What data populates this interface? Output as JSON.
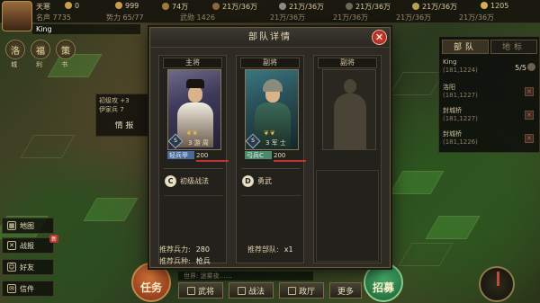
{
  "top_resources": {
    "name_prefix": "天寒",
    "val0": "0",
    "gold": "999",
    "copper": "74万",
    "wood": "21万/36万",
    "iron": "21万/36万",
    "stone": "21万/36万",
    "grain": "21万/36万",
    "reputation_label": "名声",
    "reputation": "7735",
    "power_label": "势力",
    "power": "65/77",
    "sub_label": "武勋",
    "sub_value": "1426",
    "row2_a": "21万/36万",
    "row2_b": "21万/36万",
    "row2_c": "21万/36万",
    "row2_d": "21万/36万",
    "crown": "1205",
    "player_name": "King"
  },
  "left_circles": [
    {
      "char": "洛",
      "label": "城"
    },
    {
      "char": "福",
      "label": "利"
    },
    {
      "char": "策",
      "label": "书"
    }
  ],
  "side_window": {
    "rows": [
      "初级攻 +3",
      "伊家兵 7",
      "情 报"
    ]
  },
  "left_menu": [
    {
      "label": "地图",
      "icon": "map-icon"
    },
    {
      "label": "战报",
      "icon": "swords-icon",
      "badge": "新"
    },
    {
      "label": "好友",
      "icon": "friends-icon"
    },
    {
      "label": "信件",
      "icon": "mail-icon"
    }
  ],
  "right_panel": {
    "tabs": [
      "部队",
      "地标"
    ],
    "entries": [
      {
        "name": "King",
        "sub": "(181,1224)",
        "count": "5/5"
      },
      {
        "name": "洛阳",
        "sub": "(181,1227)"
      },
      {
        "name": "封城桥",
        "sub": "(181,1227)"
      },
      {
        "name": "封城桥",
        "sub": "(181,1226)"
      }
    ]
  },
  "modal": {
    "title": "部队详情",
    "slots": [
      {
        "title": "主将",
        "level": "S",
        "star_text": "3 游 周",
        "unit_type": "轻兵甲",
        "troops": "200",
        "skill_letter": "C",
        "skill_name": "初级战法"
      },
      {
        "title": "副将",
        "level": "S",
        "star_text": "3 军 士",
        "unit_type": "弓兵C",
        "troops": "200",
        "skill_letter": "D",
        "skill_name": "勇武"
      },
      {
        "title": "副将"
      }
    ],
    "stats": {
      "rec_troops_label": "推荐兵力:",
      "rec_troops": "280",
      "rec_army_label": "推荐部队:",
      "rec_army": "x1",
      "rec_type_label": "推荐兵种:",
      "rec_type": "枪兵"
    }
  },
  "bottom": {
    "chat_placeholder": "世界: 迷雾夜……",
    "renwu": "任务",
    "buttons": [
      "武将",
      "战法",
      "政厅",
      "更多"
    ],
    "zhaomu": "招募"
  }
}
